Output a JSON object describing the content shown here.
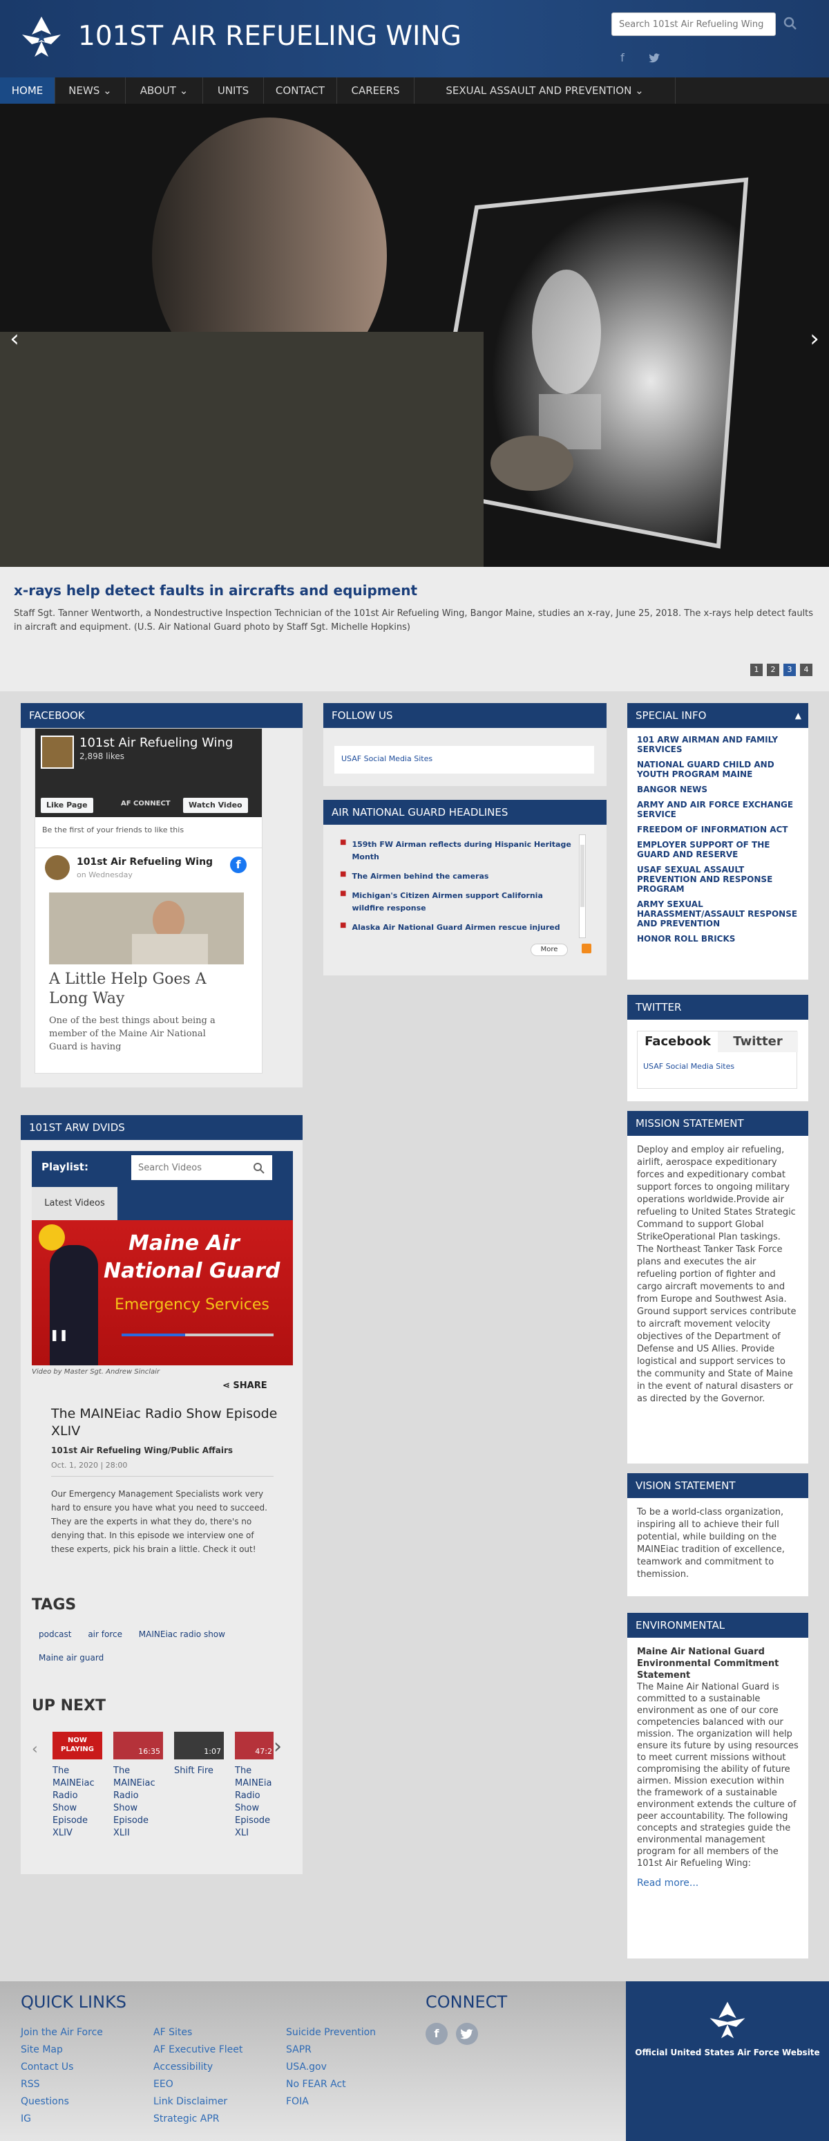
{
  "header": {
    "site_title": "101ST AIR REFUELING WING",
    "search_placeholder": "Search 101st Air Refueling Wing"
  },
  "nav": {
    "items": [
      {
        "label": "HOME",
        "active": true
      },
      {
        "label": "NEWS ⌄"
      },
      {
        "label": "ABOUT ⌄"
      },
      {
        "label": "UNITS"
      },
      {
        "label": "CONTACT"
      },
      {
        "label": "CAREERS"
      },
      {
        "label": "SEXUAL ASSAULT AND PREVENTION ⌄"
      }
    ]
  },
  "hero": {
    "title": "x-rays help detect faults in aircrafts and equipment",
    "caption": "Staff Sgt. Tanner Wentworth, a Nondestructive Inspection Technician of the 101st Air Refueling Wing, Bangor Maine, studies an x-ray, June 25, 2018. The x-rays help detect faults in aircraft and equipment. (U.S. Air National Guard photo by Staff Sgt. Michelle Hopkins)",
    "pages": [
      "1",
      "2",
      "3",
      "4"
    ],
    "active_page": "3"
  },
  "facebook": {
    "header": "FACEBOOK",
    "page_name": "101st Air Refueling Wing",
    "likes": "2,898 likes",
    "like_label": "Like Page",
    "watch_label": "Watch Video",
    "first_text": "Be the first of your friends to like this",
    "post_author": "101st Air Refueling Wing",
    "post_time": "on Wednesday",
    "story_title": "A Little Help Goes A Long Way",
    "story_text": "One of the best things about being a member of the Maine Air National Guard is having"
  },
  "follow": {
    "header": "FOLLOW US",
    "link": "USAF Social Media Sites"
  },
  "headlines": {
    "header": "AIR NATIONAL GUARD HEADLINES",
    "items": [
      "159th FW Airman reflects during Hispanic Heritage Month",
      "The Airmen behind the cameras",
      "Michigan's Citizen Airmen support California wildfire response",
      "Alaska Air National Guard Airmen rescue injured"
    ],
    "more": "More"
  },
  "special": {
    "header": "SPECIAL INFO",
    "items": [
      "101 ARW AIRMAN AND FAMILY SERVICES",
      "NATIONAL GUARD CHILD AND YOUTH PROGRAM MAINE",
      "BANGOR NEWS",
      "ARMY AND AIR FORCE EXCHANGE SERVICE",
      "FREEDOM OF INFORMATION ACT",
      "EMPLOYER SUPPORT OF THE GUARD AND RESERVE",
      "USAF SEXUAL ASSAULT PREVENTION AND RESPONSE PROGRAM",
      "ARMY SEXUAL HARASSMENT/ASSAULT RESPONSE AND PREVENTION",
      "HONOR ROLL BRICKS"
    ]
  },
  "twitter": {
    "header": "TWITTER",
    "tab1": "Facebook",
    "tab2": "Twitter",
    "link": "USAF Social Media Sites"
  },
  "mission": {
    "header": "MISSION STATEMENT",
    "text": "Deploy and employ air refueling, airlift, aerospace expeditionary forces and expeditionary combat support forces to ongoing military operations worldwide.Provide air refueling to United States Strategic Command to support Global StrikeOperational Plan taskings. The Northeast Tanker Task Force plans and executes the air refueling portion of fighter and cargo aircraft movements to and from Europe and Southwest Asia. Ground support services contribute to aircraft movement velocity objectives of the Department of Defense and US Allies. Provide logistical and support services to the community and State of Maine in the event of natural disasters or as directed by the Governor."
  },
  "vision": {
    "header": "VISION STATEMENT",
    "text": "To be a world-class organization, inspiring all to achieve their full potential, while building on the MAINEiac tradition of excellence, teamwork and commitment to themission."
  },
  "environmental": {
    "header": "ENVIRONMENTAL",
    "subtitle": "Maine Air National Guard Environmental Commitment Statement",
    "text": "The Maine Air National Guard is committed to a sustainable environment as one of our core competencies balanced with our mission. The organization will help ensure its future by using resources to meet current missions without compromising the ability of future airmen. Mission execution within the framework of a sustainable environment extends the culture of peer accountability. The following concepts and strategies guide the environmental management program for all members of the 101st Air Refueling Wing:",
    "read_more": "Read more..."
  },
  "dvids": {
    "header": "101ST ARW DVIDS",
    "playlist_label": "Playlist:",
    "search_placeholder": "Search Videos",
    "tab": "Latest Videos",
    "video_banner_line1": "Maine Air",
    "video_banner_line2": "National Guard",
    "video_banner_line3": "Emergency Services",
    "credit": "Video by Master Sgt. Andrew Sinclair",
    "share": "SHARE",
    "title": "The MAINEiac Radio Show Episode XLIV",
    "org": "101st Air Refueling Wing/Public Affairs",
    "meta": "Oct. 1, 2020 | 28:00",
    "desc": "Our Emergency Management Specialists work very hard to ensure you have what you need to succeed. They are the experts in what they do, there's no denying that. In this episode we interview one of these experts, pick his brain a little. Check it out!",
    "tags_header": "TAGS",
    "tags": [
      "podcast",
      "air force",
      "MAINEiac radio show",
      "Maine air guard"
    ],
    "upnext_header": "UP NEXT",
    "upnext": [
      {
        "badge": "NOW PLAYING",
        "title": "The MAINEiac Radio Show Episode XLIV"
      },
      {
        "badge": "16:35",
        "title": "The MAINEiac Radio Show Episode XLII"
      },
      {
        "badge": "1:07",
        "title": "Shift Fire"
      },
      {
        "badge": "47:2",
        "title": "The MAINEia Radio Show Episode XLI"
      }
    ]
  },
  "footer": {
    "quick_links_header": "QUICK LINKS",
    "col1": [
      "Join the Air Force",
      "Site Map",
      "Contact Us",
      "RSS",
      "Questions",
      "IG"
    ],
    "col2": [
      "AF Sites",
      "AF Executive Fleet",
      "Accessibility",
      "EEO",
      "Link Disclaimer",
      "Strategic APR"
    ],
    "col3": [
      "Suicide Prevention",
      "SAPR",
      "USA.gov",
      "No FEAR Act",
      "FOIA"
    ],
    "connect_header": "CONNECT",
    "af_site": "Official United States Air Force Website"
  },
  "colors": {
    "primary": "#1b3e72",
    "link": "#1d4c9b"
  }
}
